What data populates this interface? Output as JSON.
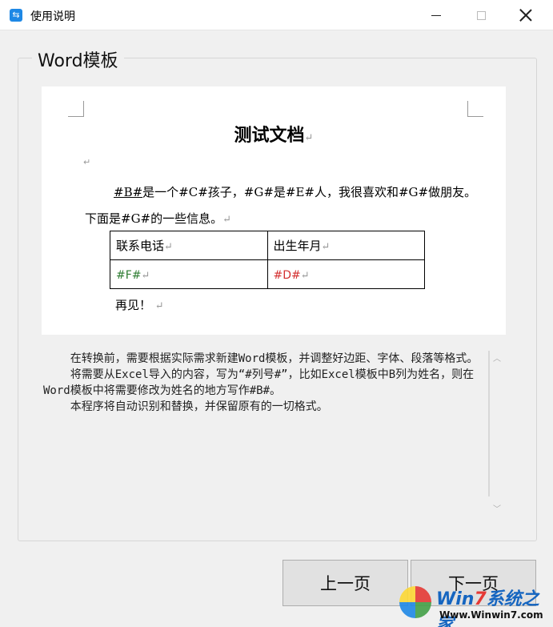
{
  "window": {
    "title": "使用说明",
    "icon": "app-icon"
  },
  "group": {
    "legend": "Word模板"
  },
  "doc": {
    "title": "测试文档",
    "return_mark": "↵",
    "para_p1": "#B#",
    "para_p2": "是一个#C#孩子，#G#是#E#人，我很喜欢和#G#做朋友。下面是#G#的一些信息。",
    "table": {
      "header_phone": "联系电话",
      "header_birth": "出生年月",
      "cell_f": "#F#",
      "cell_d": "#D#",
      "cell_f_color": "#2e7d32",
      "cell_d_color": "#d32f2f"
    },
    "closing": "再见！"
  },
  "description": {
    "text": "    在转换前，需要根据实际需求新建Word模板，并调整好边距、字体、段落等格式。\n    将需要从Excel导入的内容，写为“#列号#”，比如Excel模板中B列为姓名，则在Word模板中将需要修改为姓名的地方写作#B#。\n    本程序将自动识别和替换，并保留原有的一切格式。"
  },
  "buttons": {
    "prev": "上一页",
    "next": "下一页"
  },
  "watermark": {
    "brand_a": "Win",
    "brand_b": "7",
    "brand_c": "系统之家",
    "url": "Www.Winwin7.com"
  }
}
